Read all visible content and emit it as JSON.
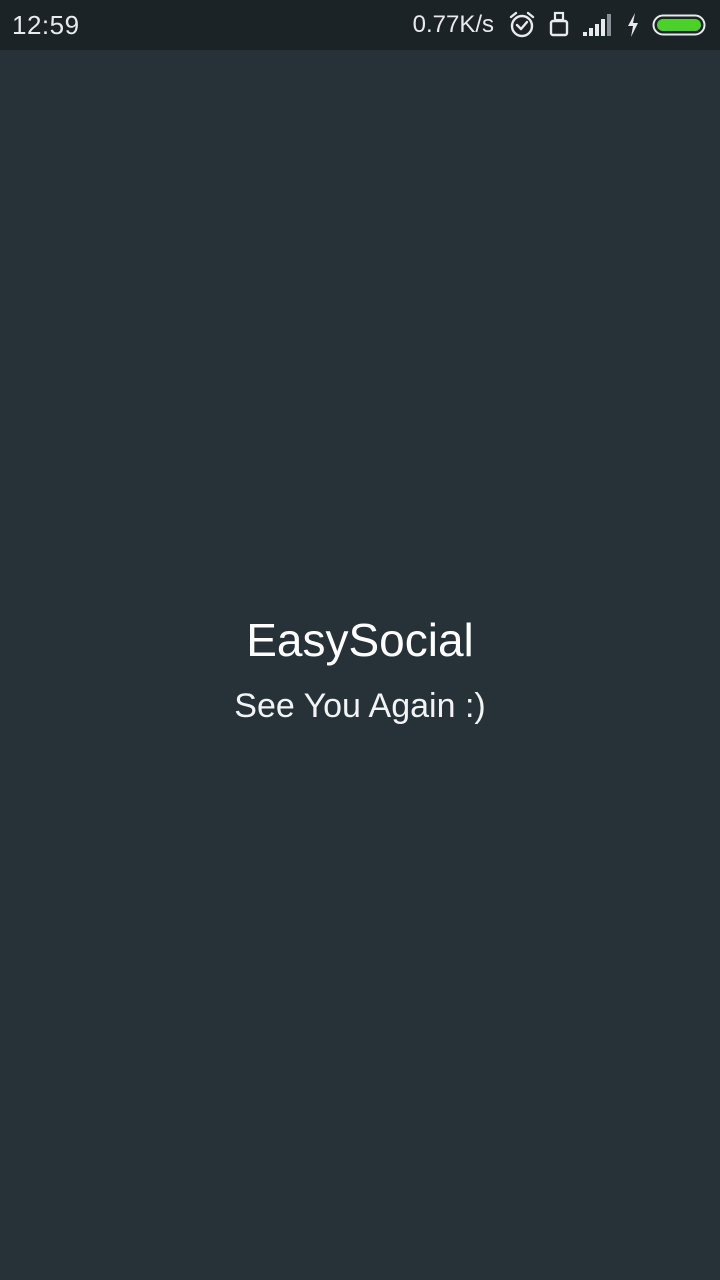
{
  "status_bar": {
    "time": "12:59",
    "network_speed": "0.77K/s",
    "icons": [
      "alarm-icon",
      "data-transfer-icon",
      "signal-icon",
      "charging-icon",
      "battery-icon"
    ],
    "battery_level": 1.0,
    "battery_color": "#4cd12a"
  },
  "splash": {
    "title": "EasySocial",
    "subtitle": "See You Again :)"
  },
  "colors": {
    "background": "#263238",
    "status_bar": "#1c2327",
    "text": "#ffffff"
  }
}
